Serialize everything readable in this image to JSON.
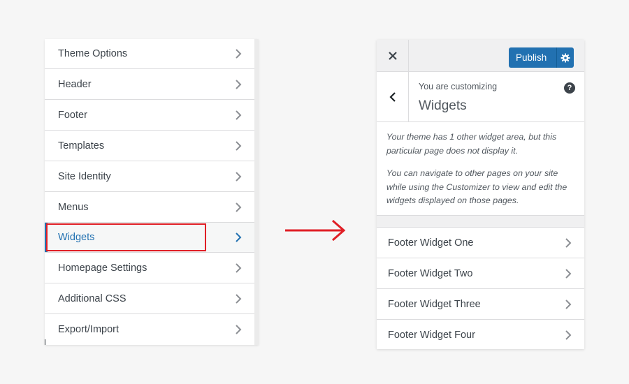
{
  "left_menu": {
    "items": [
      {
        "label": "Theme Options"
      },
      {
        "label": "Header"
      },
      {
        "label": "Footer"
      },
      {
        "label": "Templates"
      },
      {
        "label": "Site Identity"
      },
      {
        "label": "Menus"
      },
      {
        "label": "Widgets",
        "active": true
      },
      {
        "label": "Homepage Settings"
      },
      {
        "label": "Additional CSS"
      },
      {
        "label": "Export/Import"
      }
    ],
    "highlighted_item": "Widgets"
  },
  "colors": {
    "accent": "#2271b1",
    "highlight_border": "#e01f26",
    "arrow": "#e01f26",
    "chevron": "#8c8f94"
  },
  "customizer": {
    "close_icon": "close-icon",
    "publish_label": "Publish",
    "settings_icon": "gear-icon",
    "back_icon": "chevron-left-icon",
    "customizing_label": "You are customizing",
    "section_title": "Widgets",
    "help_icon": "help-icon",
    "description": [
      "Your theme has 1 other widget area, but this particular page does not display it.",
      "You can navigate to other pages on your site while using the Customizer to view and edit the widgets displayed on those pages."
    ],
    "widget_areas": [
      {
        "label": "Footer Widget One"
      },
      {
        "label": "Footer Widget Two"
      },
      {
        "label": "Footer Widget Three"
      },
      {
        "label": "Footer Widget Four"
      }
    ]
  }
}
